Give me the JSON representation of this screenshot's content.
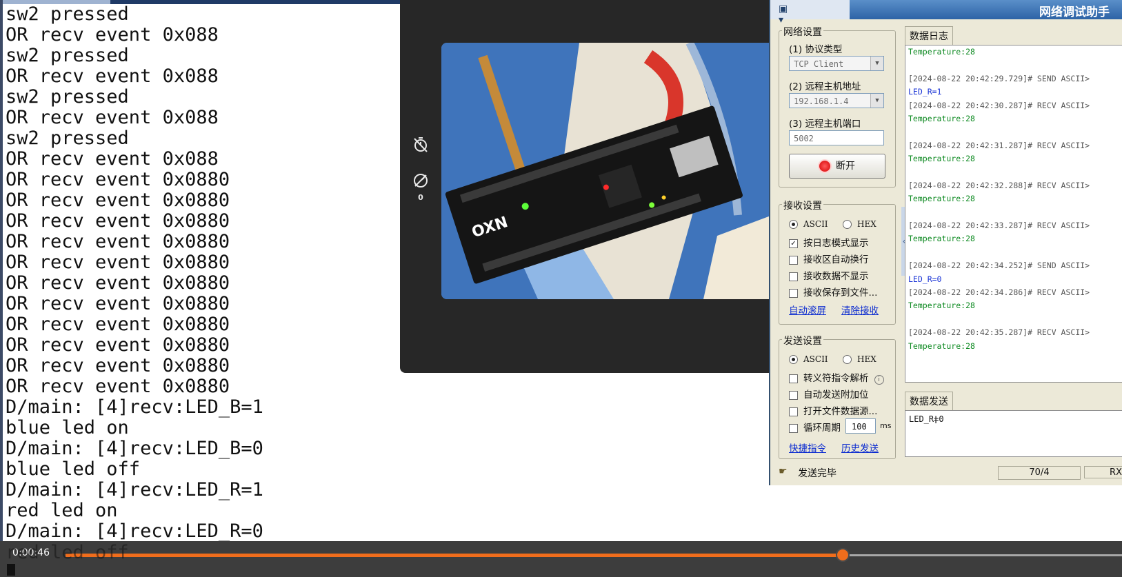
{
  "terminal": {
    "lines": [
      "sw2 pressed",
      "OR recv event 0x088",
      "sw2 pressed",
      "OR recv event 0x088",
      "sw2 pressed",
      "OR recv event 0x088",
      "sw2 pressed",
      "OR recv event 0x088",
      "OR recv event 0x0880",
      "OR recv event 0x0880",
      "OR recv event 0x0880",
      "OR recv event 0x0880",
      "OR recv event 0x0880",
      "OR recv event 0x0880",
      "OR recv event 0x0880",
      "OR recv event 0x0880",
      "OR recv event 0x0880",
      "OR recv event 0x0880",
      "OR recv event 0x0880",
      "D/main: [4]recv:LED_B=1",
      "blue led on",
      "D/main: [4]recv:LED_B=0",
      "blue led off",
      "D/main: [4]recv:LED_R=1",
      "red led on",
      "D/main: [4]recv:LED_R=0"
    ],
    "partial_last_line": "red led off"
  },
  "video_panel": {
    "timer_icon": "timer-off-icon",
    "speed_icon": "speed-off-icon",
    "speed_count": "0"
  },
  "netapp": {
    "title": "网络调试助手",
    "network_settings": {
      "group_label": "网络设置",
      "protocol_label": "(1) 协议类型",
      "protocol_value": "TCP Client",
      "remote_host_label": "(2) 远程主机地址",
      "remote_host_value": "192.168.1.4",
      "remote_port_label": "(3) 远程主机端口",
      "remote_port_value": "5002",
      "disconnect_label": "断开"
    },
    "receive_settings": {
      "group_label": "接收设置",
      "ascii_label": "ASCII",
      "hex_label": "HEX",
      "log_mode_label": "按日志模式显示",
      "auto_wrap_label": "接收区自动换行",
      "hide_data_label": "接收数据不显示",
      "save_file_label": "接收保存到文件...",
      "auto_scroll_link": "自动滚屏",
      "clear_receive_link": "清除接收"
    },
    "send_settings": {
      "group_label": "发送设置",
      "ascii_label": "ASCII",
      "hex_label": "HEX",
      "escape_label": "转义符指令解析",
      "append_label": "自动发送附加位",
      "open_file_label": "打开文件数据源...",
      "loop_label": "循环周期",
      "loop_value": "100",
      "loop_unit": "ms",
      "shortcut_link": "快捷指令",
      "history_link": "历史发送"
    },
    "log_tab": "数据日志",
    "log_lines": [
      {
        "text": "Temperature:28",
        "kind": "temp"
      },
      {
        "text": "",
        "kind": "blank"
      },
      {
        "text": "[2024-08-22 20:42:29.729]# SEND ASCII>",
        "kind": "head"
      },
      {
        "text": "LED_R=1",
        "kind": "send"
      },
      {
        "text": "[2024-08-22 20:42:30.287]# RECV ASCII>",
        "kind": "head"
      },
      {
        "text": "Temperature:28",
        "kind": "temp"
      },
      {
        "text": "",
        "kind": "blank"
      },
      {
        "text": "[2024-08-22 20:42:31.287]# RECV ASCII>",
        "kind": "head"
      },
      {
        "text": "Temperature:28",
        "kind": "temp"
      },
      {
        "text": "",
        "kind": "blank"
      },
      {
        "text": "[2024-08-22 20:42:32.288]# RECV ASCII>",
        "kind": "head"
      },
      {
        "text": "Temperature:28",
        "kind": "temp"
      },
      {
        "text": "",
        "kind": "blank"
      },
      {
        "text": "[2024-08-22 20:42:33.287]# RECV ASCII>",
        "kind": "head"
      },
      {
        "text": "Temperature:28",
        "kind": "temp"
      },
      {
        "text": "",
        "kind": "blank"
      },
      {
        "text": "[2024-08-22 20:42:34.252]# SEND ASCII>",
        "kind": "head"
      },
      {
        "text": "LED_R=0",
        "kind": "send"
      },
      {
        "text": "[2024-08-22 20:42:34.286]# RECV ASCII>",
        "kind": "head"
      },
      {
        "text": "Temperature:28",
        "kind": "temp"
      },
      {
        "text": "",
        "kind": "blank"
      },
      {
        "text": "[2024-08-22 20:42:35.287]# RECV ASCII>",
        "kind": "head"
      },
      {
        "text": "Temperature:28",
        "kind": "temp"
      }
    ],
    "send_tab": "数据发送",
    "send_text": "LED_R=0",
    "status_text": "发送完毕",
    "counter": "70/4",
    "counter_rx": "RX"
  },
  "player": {
    "time": "0:00:46",
    "progress": 0.7357
  },
  "colors": {
    "accent": "#f06d1c",
    "temp_text": "#0e8a22",
    "send_text": "#1a34d6",
    "link": "#0b2bd0"
  }
}
